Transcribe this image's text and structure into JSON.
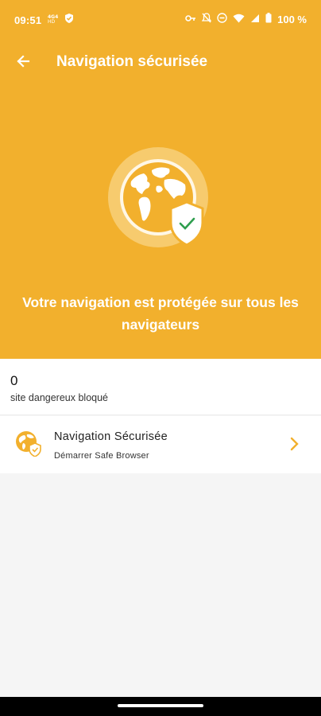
{
  "status_bar": {
    "time": "09:51",
    "battery": "100 %",
    "left_icons": [
      "data-saver-icon",
      "shield-check-icon"
    ],
    "right_icons": [
      "key-icon",
      "mute-icon",
      "dnd-icon",
      "wifi-icon",
      "signal-icon",
      "battery-icon"
    ]
  },
  "app_bar": {
    "title": "Navigation sécurisée",
    "back_icon": "arrow-back-icon"
  },
  "hero": {
    "message": "Votre navigation est protégée sur tous les navigateurs",
    "illustration": "globe-shield-icon"
  },
  "stats": {
    "count": "0",
    "label": "site dangereux bloqué"
  },
  "feature_row": {
    "title": "Navigation Sécurisée",
    "subtitle": "Démarrer Safe Browser",
    "icon": "globe-shield-icon",
    "chevron": "chevron-right-icon"
  },
  "colors": {
    "accent": "#F2B02D",
    "check": "#2E9E4E",
    "background": "#F5F5F5"
  }
}
